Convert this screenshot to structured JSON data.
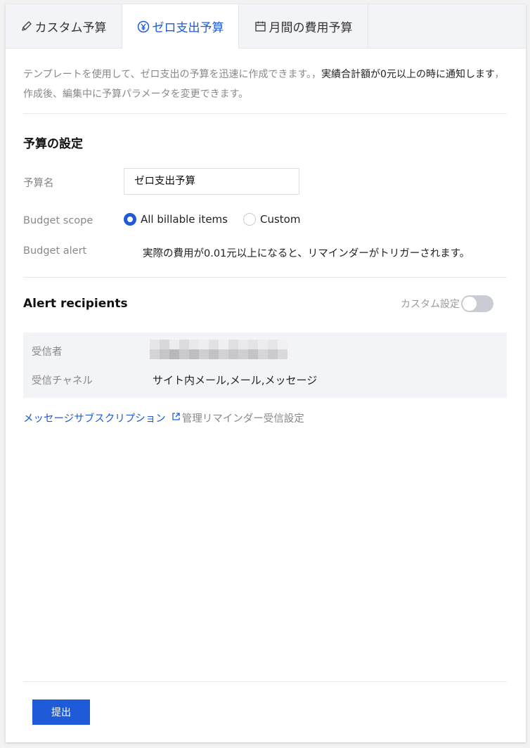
{
  "tabs": [
    {
      "label": "カスタム予算",
      "icon": "pencil-icon",
      "active": false
    },
    {
      "label": "ゼロ支出予算",
      "icon": "yen-icon",
      "active": true
    },
    {
      "label": "月間の費用予算",
      "icon": "calendar-icon",
      "active": false
    }
  ],
  "description": {
    "part1": "テンプレートを使用して、ゼロ支出の予算を迅速に作成できます。，",
    "part2": "実績合計額が0元以上の時に通知します",
    "part3": "，作成後、編集中に予算パラメータを変更できます。"
  },
  "budget_settings": {
    "title": "予算の設定",
    "name_label": "予算名",
    "name_value": "ゼロ支出予算",
    "scope_label": "Budget scope",
    "scope_options": [
      "All billable items",
      "Custom"
    ],
    "scope_selected": "All billable items",
    "alert_label": "Budget alert",
    "alert_text": "実際の費用が0.01元以上になると、リマインダーがトリガーされます。"
  },
  "recipients": {
    "title": "Alert recipients",
    "custom_label": "カスタム設定",
    "custom_enabled": false,
    "recipient_label": "受信者",
    "channel_label": "受信チャネル",
    "channel_value": "サイト内メール,メール,メッセージ"
  },
  "links": {
    "subscription": "メッセージサブスクリプション",
    "manage": "管理リマインダー受信設定"
  },
  "submit_label": "提出",
  "colors": {
    "accent": "#1f5bd8",
    "muted": "#888888",
    "panel_bg": "#f3f4f7"
  }
}
